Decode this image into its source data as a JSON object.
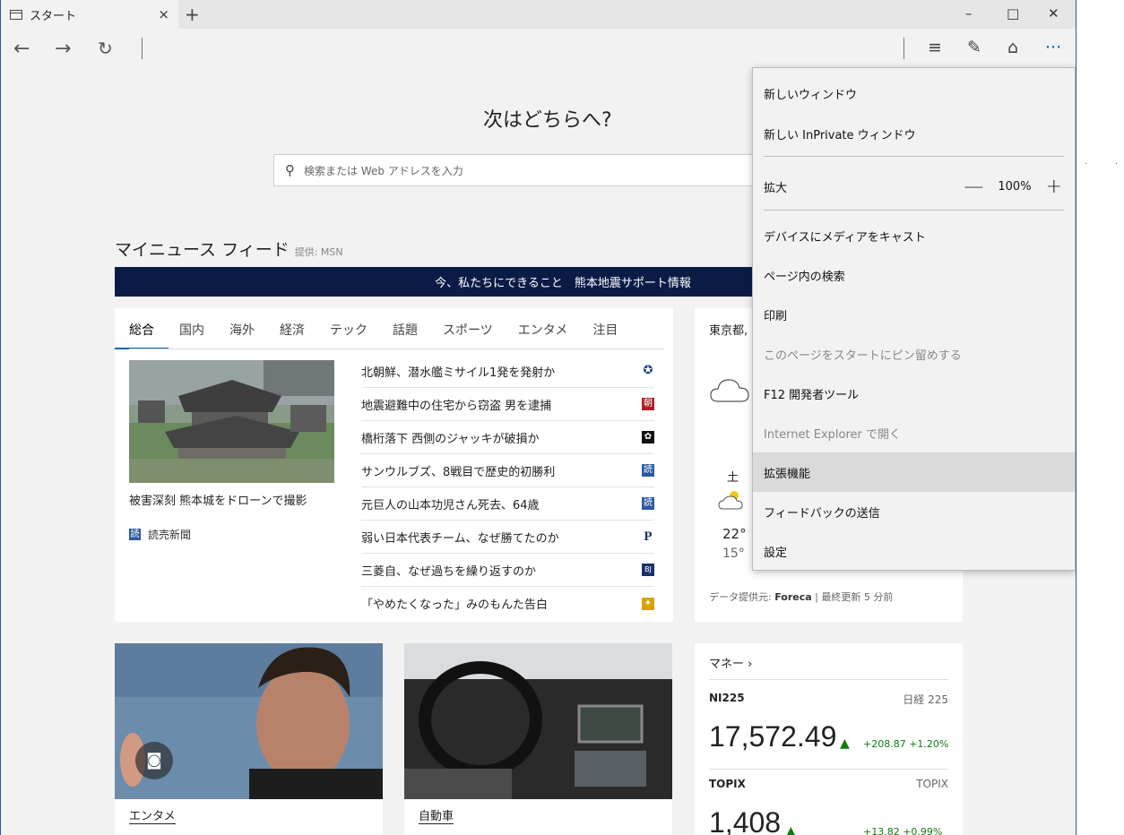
{
  "window": {
    "tab_title": "スタート",
    "tab_close": "×",
    "new_tab": "+",
    "minimize": "–",
    "maximize": "□",
    "close": "✕"
  },
  "nav": {
    "back": "←",
    "forward": "→",
    "refresh": "↻",
    "hub": "≡",
    "note": "✎",
    "share": "⌂",
    "more": "···"
  },
  "page": {
    "headline": "次はどちらへ?",
    "search_placeholder": "検索または Web アドレスを入力",
    "feed_title": "マイニュース フィード",
    "feed_provider": "提供: MSN",
    "banner": "今、私たちにできること　熊本地震サポート情報"
  },
  "news": {
    "tabs": [
      "総合",
      "国内",
      "海外",
      "経済",
      "テック",
      "話題",
      "スポーツ",
      "エンタメ",
      "注目"
    ],
    "main_caption": "被害深刻 熊本城をドローンで撮影",
    "main_source": "読売新聞",
    "main_source_logo": "読",
    "headlines": [
      {
        "text": "北朝鮮、潜水艦ミサイル1発を発射か",
        "logo": "✪",
        "color": "#1b3f8b"
      },
      {
        "text": "地震避難中の住宅から窃盗 男を逮捕",
        "logo": "朝",
        "color": "#b01e23"
      },
      {
        "text": "橋桁落下 西側のジャッキが破損か",
        "logo": "✿",
        "color": "#111111"
      },
      {
        "text": "サンウルブズ、8戦目で歴史的初勝利",
        "logo": "読",
        "color": "#2c5aa0"
      },
      {
        "text": "元巨人の山本功児さん死去、64歳",
        "logo": "読",
        "color": "#2c5aa0"
      },
      {
        "text": "弱い日本代表チーム、なぜ勝てたのか",
        "logo": "P",
        "color": "#ffffff"
      },
      {
        "text": "三菱自、なぜ過ちを繰り返すのか",
        "logo": "BJ",
        "color": "#1b2f6b"
      },
      {
        "text": "「やめたくなった」みのもんた告白",
        "logo": "✦",
        "color": "#d8a300"
      }
    ]
  },
  "weather": {
    "location": "東京都,",
    "day": "土",
    "high": "22°",
    "low": "15°",
    "footer_prefix": "データ提供元: ",
    "footer_source": "Foreca",
    "footer_suffix": " | 最終更新 5 分前"
  },
  "cards": {
    "entertainment_label": "エンタメ",
    "auto_label": "自動車"
  },
  "money": {
    "title": "マネー ›",
    "ni_name": "NI225",
    "ni_tag": "日経 225",
    "ni_value": "17,572.49",
    "ni_change": "+208.87 +1.20%",
    "topix_name": "TOPIX",
    "topix_tag": "TOPIX",
    "topix_value": "1,408",
    "topix_change": "+13.82 +0.99%"
  },
  "menu": {
    "new_window": "新しいウィンドウ",
    "new_inprivate": "新しい InPrivate ウィンドウ",
    "zoom_label": "拡大",
    "zoom_out": "—",
    "zoom_value": "100%",
    "zoom_in": "+",
    "cast": "デバイスにメディアをキャスト",
    "find": "ページ内の検索",
    "print": "印刷",
    "pin": "このページをスタートにピン留めする",
    "devtools": "F12 開発者ツール",
    "open_ie": "Internet Explorer で開く",
    "extensions": "拡張機能",
    "feedback": "フィードバックの送信",
    "settings": "設定"
  },
  "colors": {
    "accent": "#0063b1",
    "banner": "#0a1c46",
    "up_green": "#107c10"
  }
}
